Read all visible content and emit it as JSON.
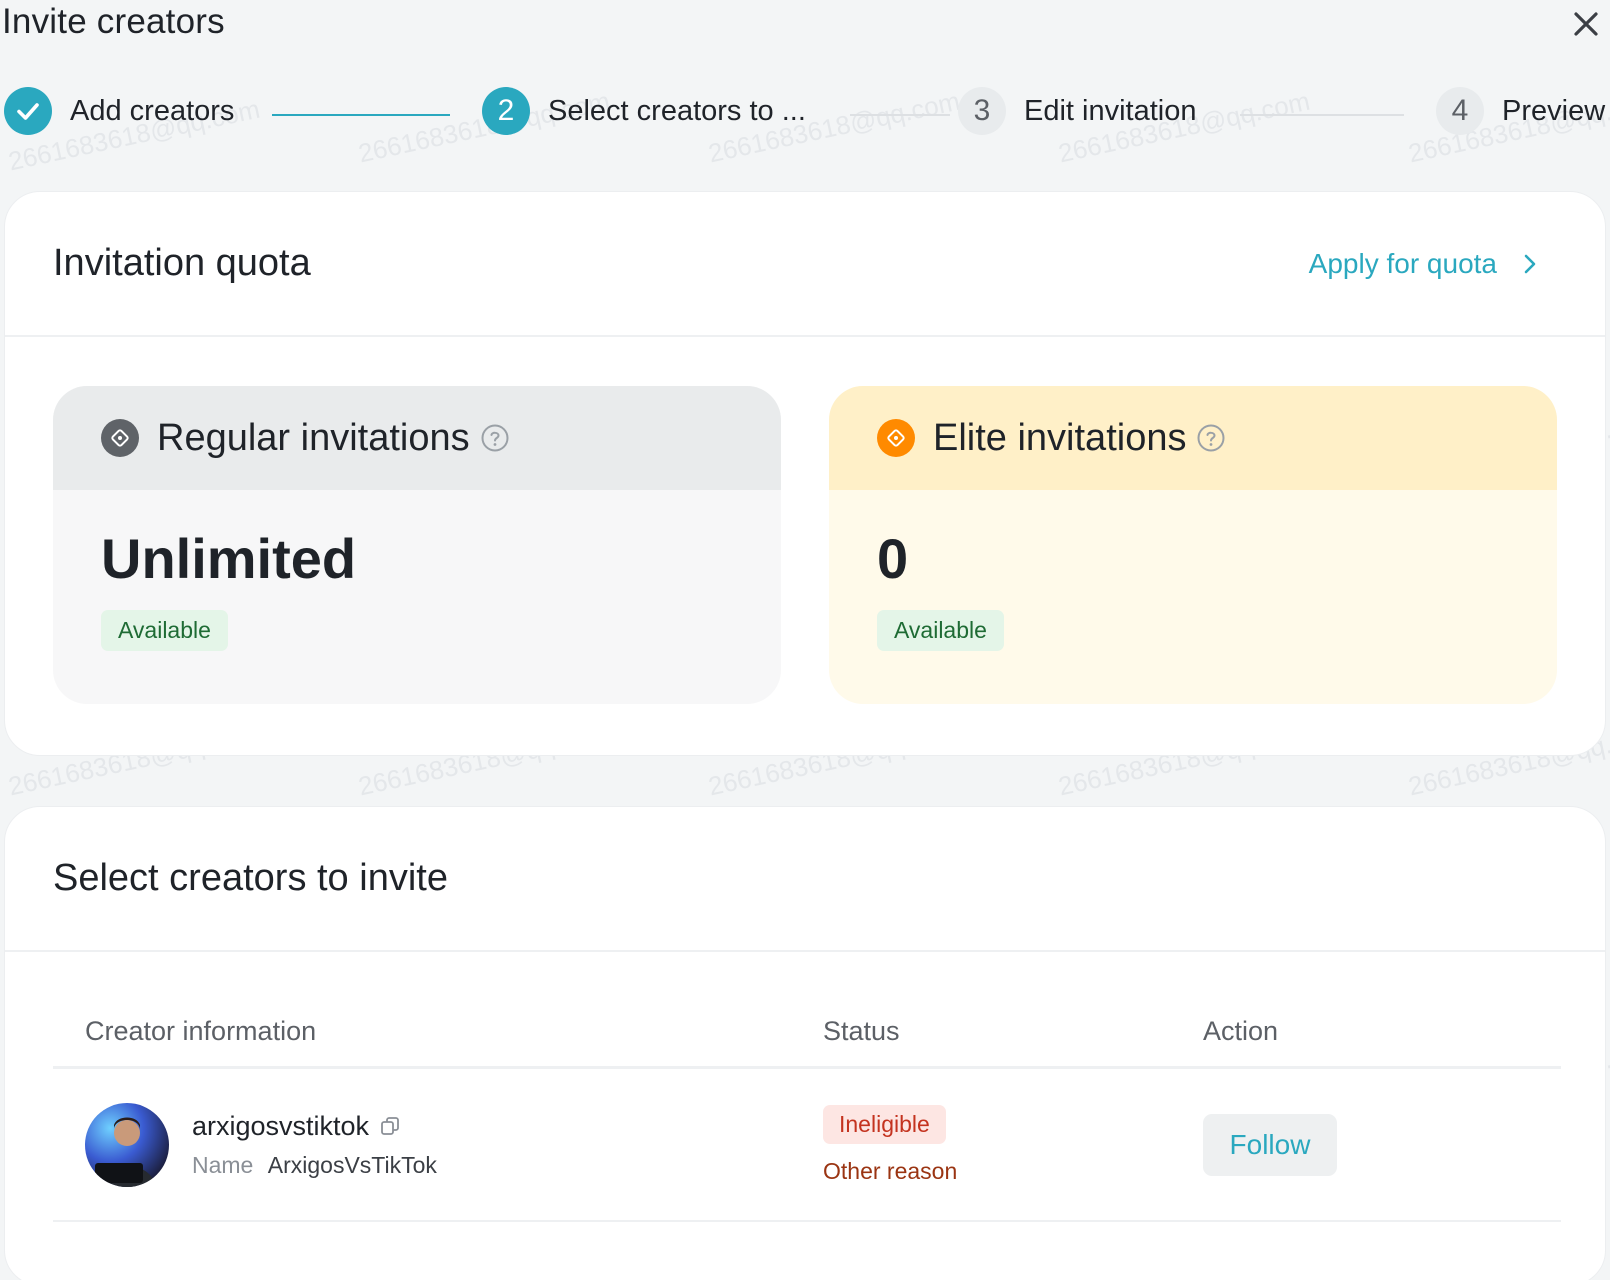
{
  "dialog": {
    "title": "Invite creators"
  },
  "stepper": {
    "steps": [
      {
        "number": "1",
        "label": "Add creators",
        "state": "done"
      },
      {
        "number": "2",
        "label": "Select creators to ...",
        "state": "active"
      },
      {
        "number": "3",
        "label": "Edit invitation",
        "state": "todo"
      },
      {
        "number": "4",
        "label": "Preview",
        "state": "todo"
      }
    ]
  },
  "quota": {
    "title": "Invitation quota",
    "apply_link": "Apply for quota",
    "regular": {
      "title": "Regular invitations",
      "value": "Unlimited",
      "badge": "Available"
    },
    "elite": {
      "title": "Elite invitations",
      "value": "0",
      "badge": "Available"
    }
  },
  "select": {
    "title": "Select creators to invite",
    "columns": {
      "info": "Creator information",
      "status": "Status",
      "action": "Action"
    },
    "rows": [
      {
        "handle": "arxigosvstiktok",
        "name_label": "Name",
        "name_value": "ArxigosVsTikTok",
        "status_badge": "Ineligible",
        "status_reason": "Other reason",
        "action_label": "Follow"
      }
    ]
  },
  "watermark": "2661683618@qq.com",
  "colors": {
    "accent": "#2aa8bf",
    "available_bg": "#e4f5e8",
    "ineligible_bg": "#fde6e3",
    "elite_bg": "#fffaea"
  }
}
